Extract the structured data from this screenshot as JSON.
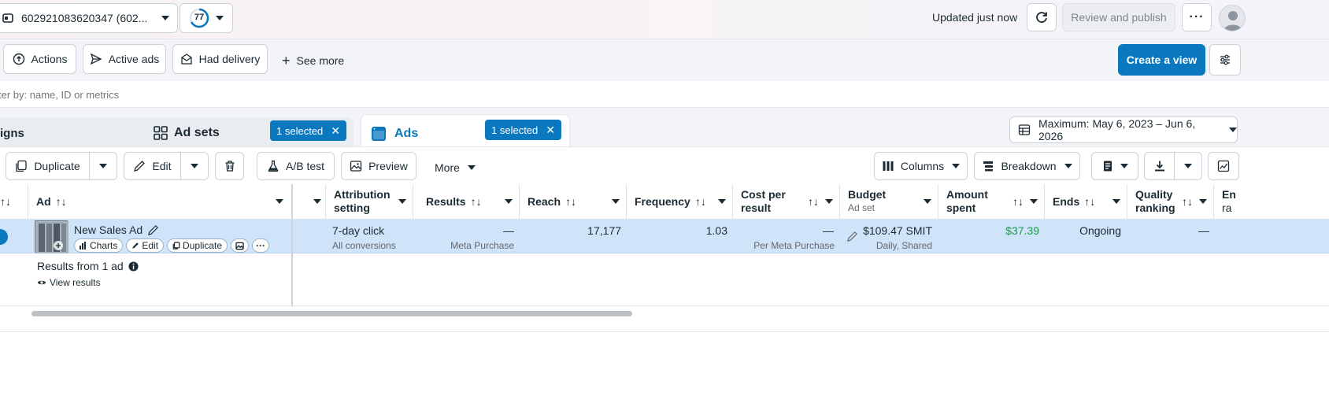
{
  "topbar": {
    "account_label": "602921083620347 (602...",
    "score": "77",
    "updated": "Updated just now",
    "review_publish": "Review and publish"
  },
  "filters": {
    "actions": "Actions",
    "active_ads": "Active ads",
    "had_delivery": "Had delivery",
    "see_more": "See more",
    "create_view": "Create a view"
  },
  "search": {
    "placeholder": "ter by: name, ID or metrics"
  },
  "tabs": {
    "campaigns": "igns",
    "ad_sets": "Ad sets",
    "ad_sets_selected": "1 selected",
    "ads": "Ads",
    "ads_selected": "1 selected",
    "date_range": "Maximum: May 6, 2023 – Jun 6, 2026"
  },
  "toolbar": {
    "duplicate": "Duplicate",
    "edit": "Edit",
    "ab_test": "A/B test",
    "preview": "Preview",
    "more": "More",
    "columns": "Columns",
    "breakdown": "Breakdown"
  },
  "table": {
    "headers": {
      "ad": "Ad",
      "attribution_1": "Attribution",
      "attribution_2": "setting",
      "results": "Results",
      "reach": "Reach",
      "frequency": "Frequency",
      "cpr_1": "Cost per",
      "cpr_2": "result",
      "budget": "Budget",
      "budget_sub": "Ad set",
      "amount_1": "Amount",
      "amount_2": "spent",
      "ends": "Ends",
      "quality_1": "Quality",
      "quality_2": "ranking",
      "en_1": "En",
      "en_2": "ra"
    },
    "row": {
      "name": "New Sales Ad",
      "charts": "Charts",
      "edit": "Edit",
      "duplicate": "Duplicate",
      "attribution": "7-day click",
      "attribution_sub": "All conversions",
      "results": "—",
      "results_sub": "Meta Purchase",
      "reach": "17,177",
      "frequency": "1.03",
      "cpr": "—",
      "cpr_sub": "Per Meta Purchase",
      "budget": "$109.47 SMIT",
      "budget_sub": "Daily, Shared",
      "amount": "$37.39",
      "ends": "Ongoing",
      "quality": "—"
    },
    "summary": {
      "label": "Results from 1 ad",
      "view": "View results"
    }
  },
  "colors": {
    "accent": "#0a78be",
    "row_selected": "#cfe3f9",
    "amount_green": "#1a9b4e"
  }
}
